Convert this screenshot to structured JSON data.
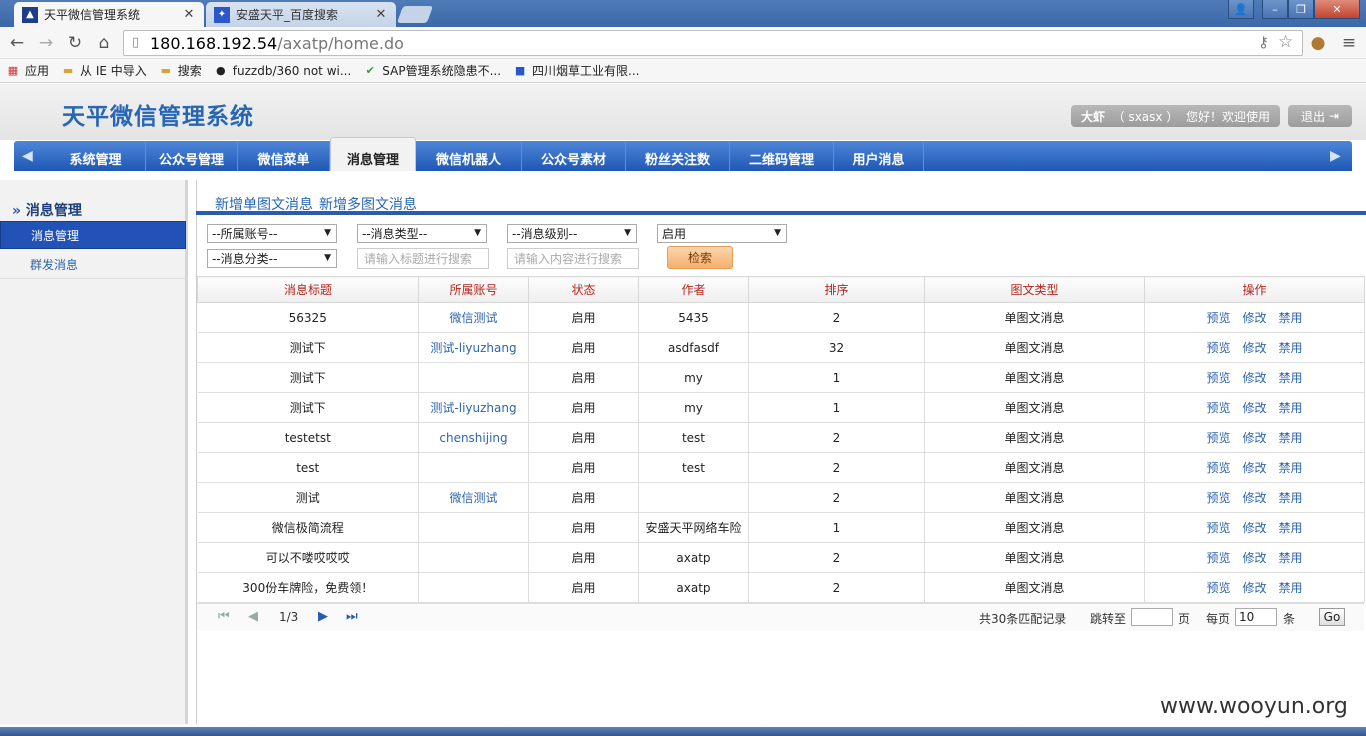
{
  "browser": {
    "tabs": [
      {
        "title": "天平微信管理系统",
        "active": true
      },
      {
        "title": "安盛天平_百度搜索",
        "active": false
      }
    ],
    "url_host": "180.168.192.54",
    "url_path": "/axatp/home.do",
    "bookmarks": [
      "应用",
      "从 IE 中导入",
      "搜索",
      "fuzzdb/360 not wi...",
      "SAP管理系统隐患不...",
      "四川烟草工业有限..."
    ]
  },
  "app": {
    "title": "天平微信管理系统",
    "user_name": "大虾",
    "user_id": "（ sxasx ）",
    "greeting": "您好！欢迎使用",
    "logout_label": "退出"
  },
  "nav": {
    "items": [
      "系统管理",
      "公众号管理",
      "微信菜单",
      "消息管理",
      "微信机器人",
      "公众号素材",
      "粉丝关注数",
      "二维码管理",
      "用户消息"
    ],
    "active": "消息管理"
  },
  "sidebar": {
    "header": "消息管理",
    "items": [
      "消息管理",
      "群发消息"
    ]
  },
  "content": {
    "tab_single": "新增单图文消息",
    "tab_multi": "新增多图文消息",
    "filters": {
      "account": "--所属账号--",
      "msg_type": "--消息类型--",
      "msg_level": "--消息级别--",
      "status": "启用",
      "category": "--消息分类--",
      "title_placeholder": "请输入标题进行搜索",
      "content_placeholder": "请输入内容进行搜索",
      "search_label": "检索"
    },
    "table": {
      "headers": [
        "消息标题",
        "所属账号",
        "状态",
        "作者",
        "排序",
        "图文类型",
        "操作"
      ],
      "ops": [
        "预览",
        "修改",
        "禁用"
      ],
      "rows": [
        [
          "56325",
          "微信测试",
          "启用",
          "5435",
          "2",
          "单图文消息"
        ],
        [
          "测试下",
          "测试-liyuzhang",
          "启用",
          "asdfasdf",
          "32",
          "单图文消息"
        ],
        [
          "测试下",
          "",
          "启用",
          "my",
          "1",
          "单图文消息"
        ],
        [
          "测试下",
          "测试-liyuzhang",
          "启用",
          "my",
          "1",
          "单图文消息"
        ],
        [
          "testetst",
          "chenshijing",
          "启用",
          "test",
          "2",
          "单图文消息"
        ],
        [
          "test",
          "",
          "启用",
          "test",
          "2",
          "单图文消息"
        ],
        [
          "测试",
          "微信测试",
          "启用",
          "",
          "2",
          "单图文消息"
        ],
        [
          "微信极简流程",
          "",
          "启用",
          "安盛天平网络车险",
          "1",
          "单图文消息"
        ],
        [
          "可以不喽哎哎哎",
          "",
          "启用",
          "axatp",
          "2",
          "单图文消息"
        ],
        [
          "300份车牌险，免费领！",
          "",
          "启用",
          "axatp",
          "2",
          "单图文消息"
        ]
      ]
    },
    "pager": {
      "page_info": "1/3",
      "total": "共30条匹配记录",
      "jump_label": "跳转至",
      "page_unit": "页",
      "per_page_label": "每页",
      "per_page_value": "10",
      "per_page_unit": "条",
      "go_label": "Go"
    }
  },
  "watermark": "www.wooyun.org"
}
